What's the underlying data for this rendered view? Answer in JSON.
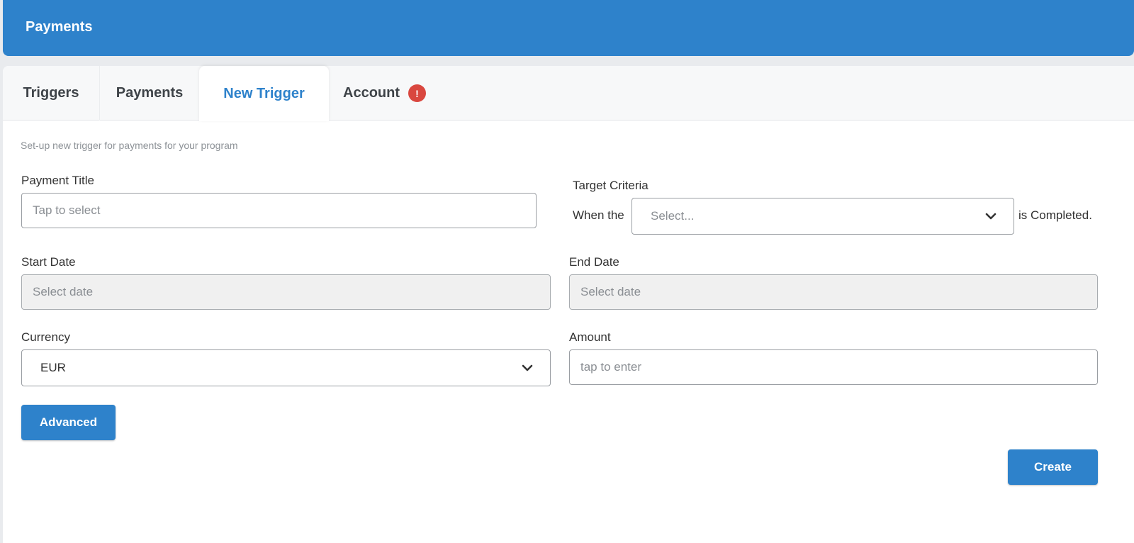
{
  "header": {
    "title": "Payments"
  },
  "tabs": [
    {
      "label": "Triggers",
      "active": false
    },
    {
      "label": "Payments",
      "active": false
    },
    {
      "label": "New Trigger",
      "active": true
    },
    {
      "label": "Account",
      "active": false,
      "badge": "!"
    }
  ],
  "form": {
    "subtitle": "Set-up new trigger for payments for your program",
    "payment_title": {
      "label": "Payment Title",
      "placeholder": "Tap to select"
    },
    "target_criteria": {
      "label": "Target Criteria",
      "prefix": "When the",
      "select_placeholder": "Select...",
      "suffix": "is Completed."
    },
    "start_date": {
      "label": "Start Date",
      "placeholder": "Select date"
    },
    "end_date": {
      "label": "End Date",
      "placeholder": "Select date"
    },
    "currency": {
      "label": "Currency",
      "value": "EUR"
    },
    "amount": {
      "label": "Amount",
      "placeholder": "tap to enter"
    }
  },
  "buttons": {
    "advanced": "Advanced",
    "create": "Create"
  },
  "colors": {
    "brand": "#2e82cb",
    "alert": "#d9473f",
    "disabled_bg": "#f0f0f0"
  }
}
